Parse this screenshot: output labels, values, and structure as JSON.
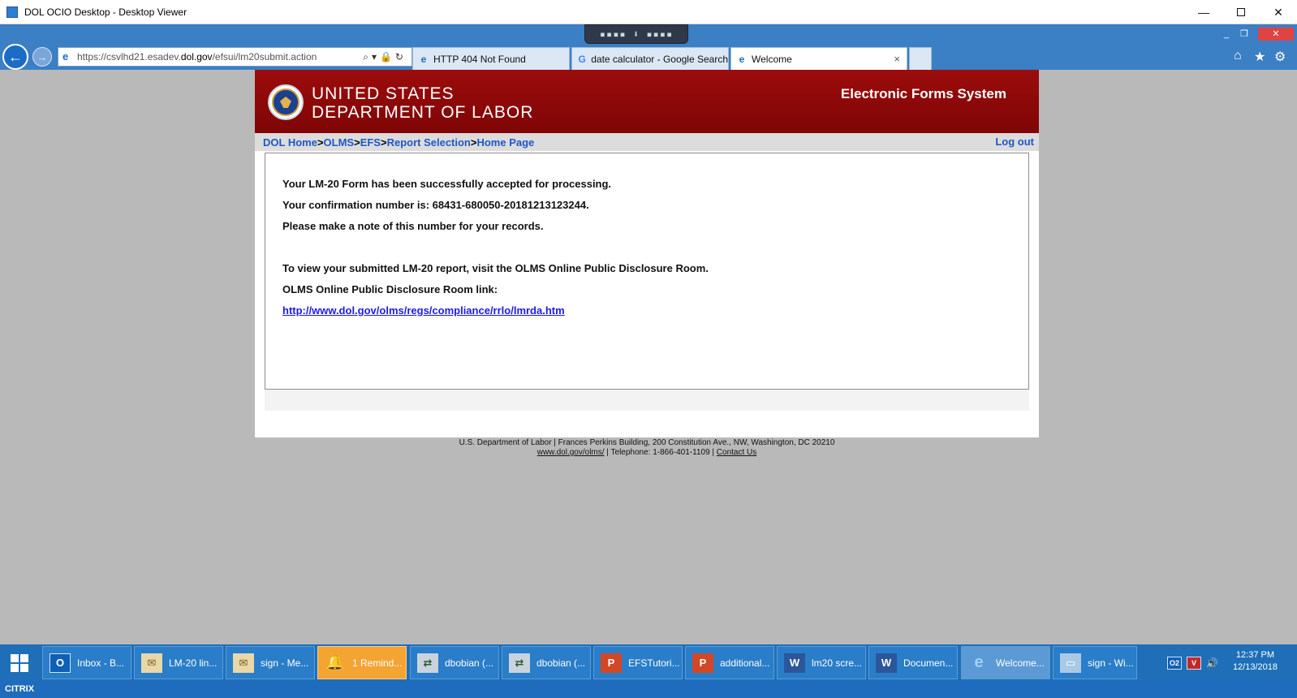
{
  "window": {
    "title": "DOL OCIO Desktop - Desktop Viewer",
    "min_glyph": "—",
    "close_glyph": "✕"
  },
  "browser": {
    "url_prefix": "https://csvlhd21.esadev.",
    "url_domain": "dol.gov",
    "url_path": "/efsui/lm20submit.action",
    "addr_icons": "⌕▾🔒↻",
    "tabs": [
      {
        "label": "HTTP 404 Not Found",
        "icon": "ie-icon"
      },
      {
        "label": "date calculator - Google Search",
        "icon": "google-icon"
      },
      {
        "label": "Welcome",
        "icon": "ie-icon",
        "active": true
      }
    ],
    "tab_close_glyph": "×",
    "citrix_handle_text": "▪▪▪▪ ⬇ ▪▪▪▪",
    "inner_min_glyph": "_",
    "inner_restore_glyph": "❐",
    "inner_close_glyph": "✕",
    "home_glyph": "⌂",
    "favorites_glyph": "★",
    "settings_glyph": "⚙"
  },
  "header": {
    "agency_line1": "UNITED STATES",
    "agency_line2": "DEPARTMENT OF LABOR",
    "system_title": "Electronic Forms System"
  },
  "breadcrumb": {
    "items": [
      "DOL Home",
      "OLMS",
      "EFS",
      "Report Selection",
      "Home Page"
    ],
    "separators": [
      "> ",
      "> ",
      " >",
      " >"
    ],
    "logout": "Log out"
  },
  "content": {
    "line1": "Your LM-20 Form has been successfully accepted for processing.",
    "line2": "Your confirmation number is: 68431-680050-20181213123244.",
    "line3": "Please make a note of this number for your records.",
    "line4": "To view your submitted LM-20 report, visit the OLMS Online Public Disclosure Room.",
    "line5": "OLMS Online Public Disclosure Room link:",
    "link": "http://www.dol.gov/olms/regs/compliance/rrlo/lmrda.htm"
  },
  "footer": {
    "line1": "U.S. Department of Labor | Frances Perkins Building, 200 Constitution Ave., NW, Washington, DC 20210",
    "link1": "www.dol.gov/olms/",
    "sep1": " | Telephone: 1-866-401-1109 | ",
    "link2": "Contact Us"
  },
  "taskbar": {
    "items": [
      {
        "label": "Inbox - B...",
        "icon": "outlook-icon",
        "glyph": "O"
      },
      {
        "label": "LM-20 lin...",
        "icon": "mail-icon",
        "glyph": "✉"
      },
      {
        "label": "sign - Me...",
        "icon": "mail-icon",
        "glyph": "✉"
      },
      {
        "label": "1 Remind...",
        "icon": "bell-icon",
        "glyph": "🔔"
      },
      {
        "label": "dbobian (...",
        "icon": "network-icon",
        "glyph": "⇄"
      },
      {
        "label": "dbobian (...",
        "icon": "network-icon",
        "glyph": "⇄"
      },
      {
        "label": "EFSTutori...",
        "icon": "powerpoint-icon",
        "glyph": "P"
      },
      {
        "label": "additional...",
        "icon": "powerpoint-icon",
        "glyph": "P"
      },
      {
        "label": "lm20 scre...",
        "icon": "word-icon",
        "glyph": "W"
      },
      {
        "label": "Documen...",
        "icon": "word-icon",
        "glyph": "W"
      },
      {
        "label": "Welcome...",
        "icon": "ie-icon",
        "glyph": "e"
      },
      {
        "label": "sign - Wi...",
        "icon": "remote-desktop-icon",
        "glyph": "▭"
      }
    ],
    "tray_outlook": "O2",
    "tray_shield": "V",
    "tray_volume": "🔊",
    "clock_time": "12:37 PM",
    "clock_date": "12/13/2018"
  },
  "citrix": {
    "label": "CITRIX"
  }
}
